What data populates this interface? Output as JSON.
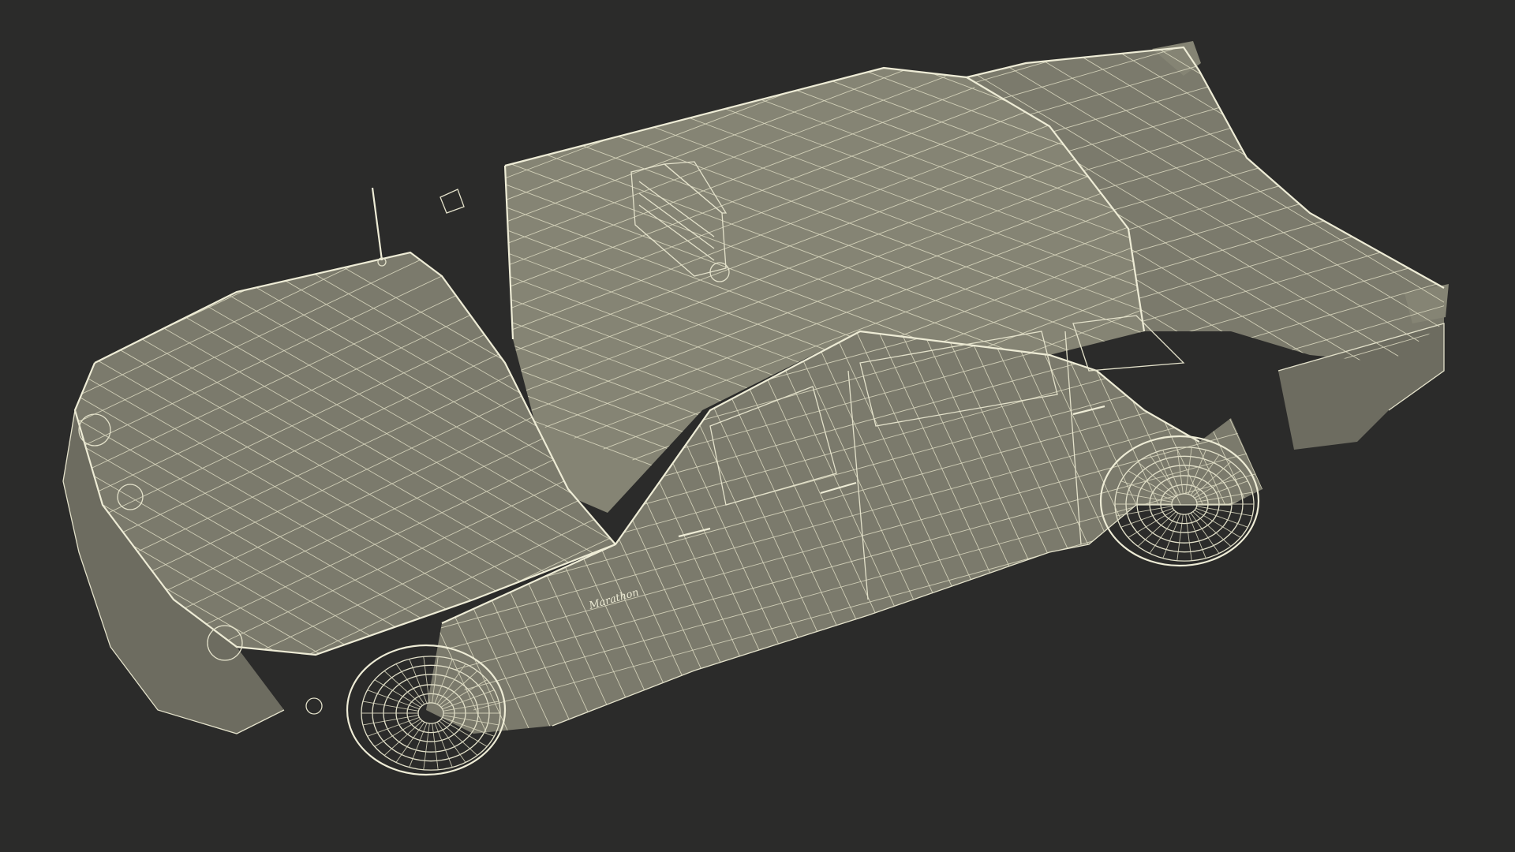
{
  "scene": {
    "background": "#2b2b2a",
    "model_fill": "#7b7a6c",
    "wire_color": "#e4e2cb"
  },
  "badge": {
    "text": "Marathon"
  }
}
